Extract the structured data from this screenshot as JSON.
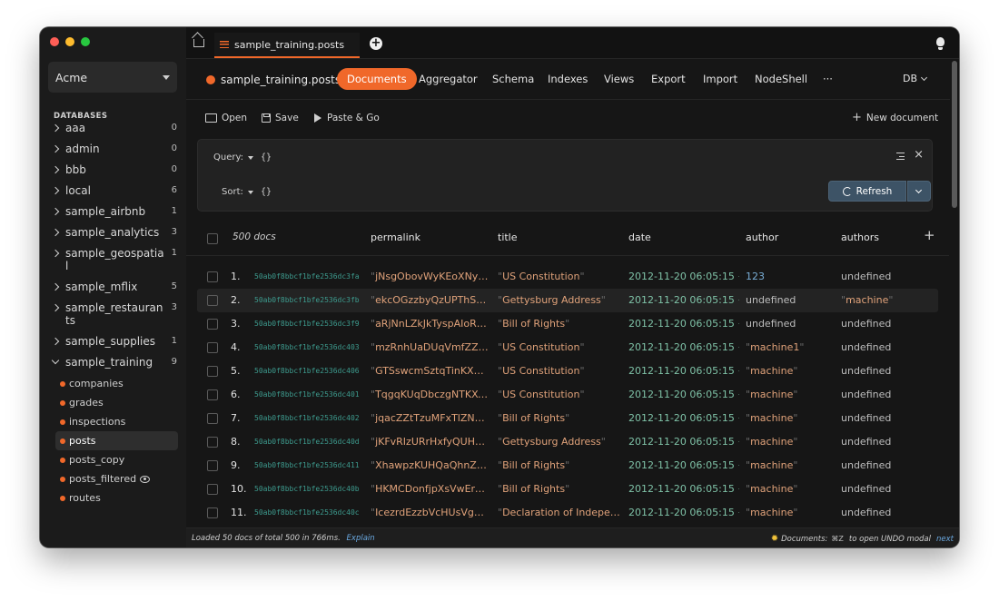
{
  "colors": {
    "accent": "#f0682a",
    "traffic_red": "#ff5f57",
    "traffic_yellow": "#febc2e",
    "traffic_green": "#28c840"
  },
  "sidebar": {
    "org": "Acme",
    "databases_heading": "DATABASES",
    "databases": [
      {
        "name": "aaa",
        "count": "0"
      },
      {
        "name": "admin",
        "count": "0"
      },
      {
        "name": "bbb",
        "count": "0"
      },
      {
        "name": "local",
        "count": "6"
      },
      {
        "name": "sample_airbnb",
        "count": "1"
      },
      {
        "name": "sample_analytics",
        "count": "3"
      },
      {
        "name": "sample_geospatial",
        "count": "1"
      },
      {
        "name": "sample_mflix",
        "count": "5"
      },
      {
        "name": "sample_restaurants",
        "count": "3"
      },
      {
        "name": "sample_supplies",
        "count": "1"
      },
      {
        "name": "sample_training",
        "count": "9"
      }
    ],
    "collections": [
      "companies",
      "grades",
      "inspections",
      "posts",
      "posts_copy",
      "posts_filtered",
      "routes"
    ]
  },
  "tabbar": {
    "tab_label": "sample_training.posts"
  },
  "navbar": {
    "collection_label": "sample_training.posts:",
    "tabs": [
      "Documents",
      "Aggregator",
      "Schema",
      "Indexes",
      "Views",
      "Export",
      "Import",
      "NodeShell",
      "···"
    ],
    "db_label": "DB"
  },
  "toolbar": {
    "open": "Open",
    "save": "Save",
    "paste_go": "Paste & Go",
    "new_document": "New document"
  },
  "query": {
    "query_label": "Query:",
    "query_value": "{}",
    "sort_label": "Sort:",
    "sort_value": "{}",
    "refresh": "Refresh"
  },
  "grid": {
    "doc_count": "500 docs",
    "columns": [
      "permalink",
      "title",
      "date",
      "author",
      "authors"
    ],
    "rows": [
      {
        "n": "1.",
        "id": "50ab0f8bbcf1bfe2536dc3fa",
        "permalink": "jNsgObovWyKEoXNydtis",
        "title": "US Constitution",
        "date": "2012-11-20 06:05:15 +...",
        "author": "123",
        "author_type": "num",
        "authors": "undefined",
        "authors_type": "undef"
      },
      {
        "n": "2.",
        "id": "50ab0f8bbcf1bfe2536dc3fb",
        "permalink": "ekcOGzzbyQzUPThSxR...",
        "title": "Gettysburg Address",
        "date": "2012-11-20 06:05:15 +...",
        "author": "undefined",
        "author_type": "undef",
        "authors": "machine",
        "authors_type": "str"
      },
      {
        "n": "3.",
        "id": "50ab0f8bbcf1bfe2536dc3f9",
        "permalink": "aRjNnLZkJkTyspAIoRGe",
        "title": "Bill of Rights",
        "date": "2012-11-20 06:05:15 +...",
        "author": "undefined",
        "author_type": "undef",
        "authors": "undefined",
        "authors_type": "undef"
      },
      {
        "n": "4.",
        "id": "50ab0f8bbcf1bfe2536dc403",
        "permalink": "mzRnhUaDUqVmfZZaP...",
        "title": "US Constitution",
        "date": "2012-11-20 06:05:15 +...",
        "author": "machine1",
        "author_type": "str",
        "authors": "undefined",
        "authors_type": "undef"
      },
      {
        "n": "5.",
        "id": "50ab0f8bbcf1bfe2536dc406",
        "permalink": "GTSswcmSztqTinKXDA...",
        "title": "US Constitution",
        "date": "2012-11-20 06:05:15 +...",
        "author": "machine",
        "author_type": "str",
        "authors": "undefined",
        "authors_type": "undef"
      },
      {
        "n": "6.",
        "id": "50ab0f8bbcf1bfe2536dc401",
        "permalink": "TqgqKUqDbczgNTKXOj...",
        "title": "US Constitution",
        "date": "2012-11-20 06:05:15 +...",
        "author": "machine",
        "author_type": "str",
        "authors": "undefined",
        "authors_type": "undef"
      },
      {
        "n": "7.",
        "id": "50ab0f8bbcf1bfe2536dc402",
        "permalink": "jqacZZtTzuMFxTlZNkrH",
        "title": "Bill of Rights",
        "date": "2012-11-20 06:05:15 +...",
        "author": "machine",
        "author_type": "str",
        "authors": "undefined",
        "authors_type": "undef"
      },
      {
        "n": "8.",
        "id": "50ab0f8bbcf1bfe2536dc40d",
        "permalink": "jKFvRIzURrHxfyQUHpPc",
        "title": "Gettysburg Address",
        "date": "2012-11-20 06:05:15 +...",
        "author": "machine",
        "author_type": "str",
        "authors": "undefined",
        "authors_type": "undef"
      },
      {
        "n": "9.",
        "id": "50ab0f8bbcf1bfe2536dc411",
        "permalink": "XhawpzKUHQaQhnZIZ...",
        "title": "Bill of Rights",
        "date": "2012-11-20 06:05:15 +...",
        "author": "machine",
        "author_type": "str",
        "authors": "undefined",
        "authors_type": "undef"
      },
      {
        "n": "10.",
        "id": "50ab0f8bbcf1bfe2536dc40b",
        "permalink": "HKMCDonfjpXsVwErqiCL",
        "title": "Bill of Rights",
        "date": "2012-11-20 06:05:15 +...",
        "author": "machine",
        "author_type": "str",
        "authors": "undefined",
        "authors_type": "undef"
      },
      {
        "n": "11.",
        "id": "50ab0f8bbcf1bfe2536dc40c",
        "permalink": "IcezrdEzzbVcHUsVgbPB",
        "title": "Declaration of Independ...",
        "date": "2012-11-20 06:05:15 +...",
        "author": "machine",
        "author_type": "str",
        "authors": "undefined",
        "authors_type": "undef"
      }
    ]
  },
  "status": {
    "loaded_text": "Loaded 50 docs of total 500 in 766ms.",
    "explain_link": "Explain",
    "hint_label": "Documents:",
    "hint_shortcut": "⌘Z",
    "hint_text": "to open UNDO modal",
    "next_link": "next"
  }
}
